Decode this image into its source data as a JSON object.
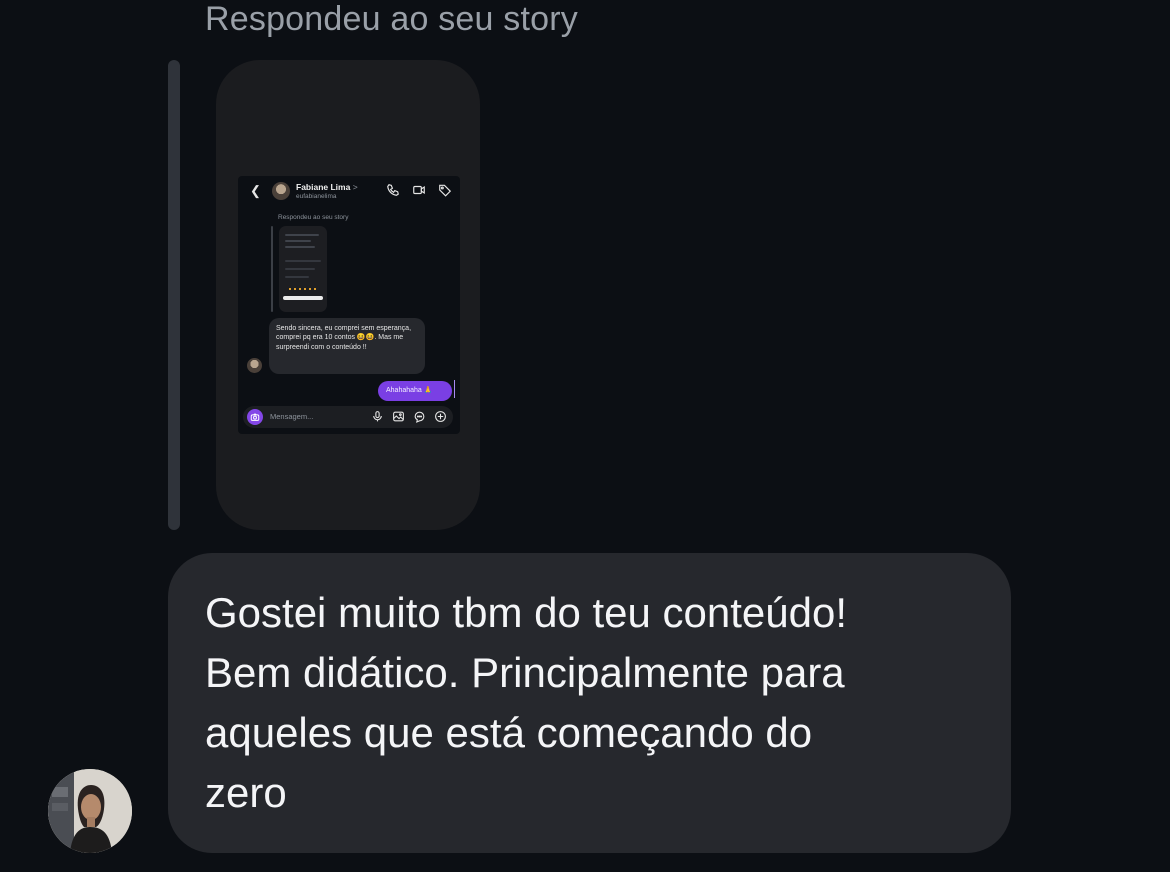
{
  "story": {
    "caption": "Respondeu ao seu story",
    "screenshot": {
      "contact_name": "Fabiane Lima",
      "contact_name_chevron": ">",
      "contact_handle": "eufabianelima",
      "caption": "Respondeu ao seu story",
      "incoming_message": "Sendo sincera, eu comprei sem esperança, comprei pq era 10 contos 😆😆. Mas me surpreendi com o conteúdo !!",
      "outgoing_message": "Ahahahaha 🙏",
      "input_placeholder": "Mensagem...",
      "icons": [
        "back-arrow-icon",
        "phone-icon",
        "video-icon",
        "tag-icon",
        "camera-icon",
        "microphone-icon",
        "gallery-icon",
        "sticker-icon",
        "plus-icon"
      ]
    }
  },
  "message": {
    "text": "Gostei muito tbm do teu conteúdo!\nBem didático. Principalmente para\naqueles que está começando do\nzero"
  },
  "colors": {
    "background": "#0c0f14",
    "bubble": "#26282d",
    "caption": "#9aa0a8",
    "outgoing_bubble": "#7a3fe4"
  }
}
